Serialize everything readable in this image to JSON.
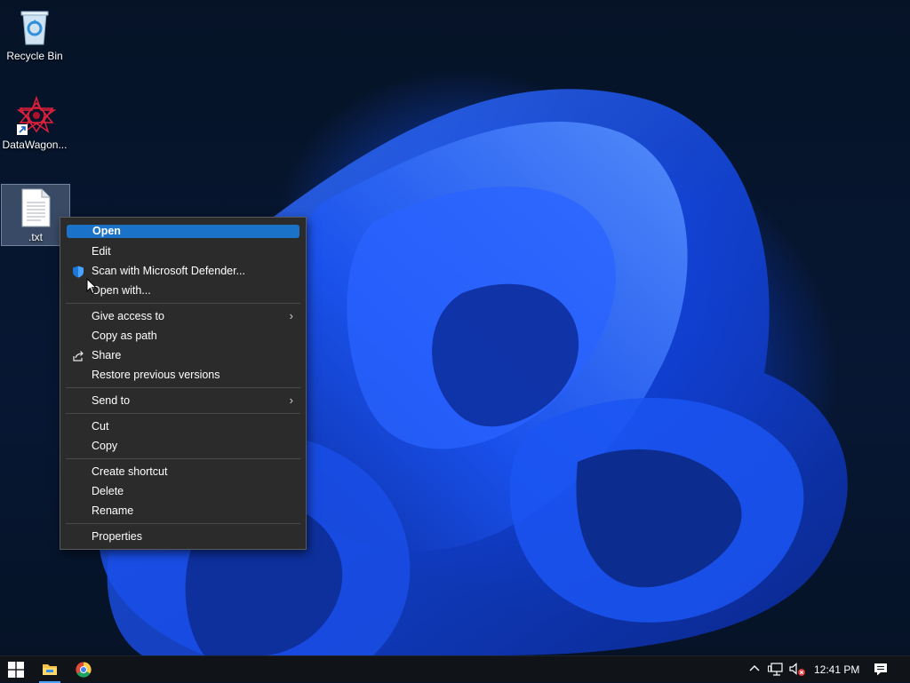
{
  "desktop": {
    "icons": [
      {
        "label": "Recycle Bin"
      },
      {
        "label": "DataWagon..."
      },
      {
        "label": ".txt"
      }
    ]
  },
  "context_menu": {
    "items": [
      {
        "label": "Open"
      },
      {
        "label": "Edit"
      },
      {
        "label": "Scan with Microsoft Defender..."
      },
      {
        "label": "Open with..."
      },
      {
        "label": "Give access to"
      },
      {
        "label": "Copy as path"
      },
      {
        "label": "Share"
      },
      {
        "label": "Restore previous versions"
      },
      {
        "label": "Send to"
      },
      {
        "label": "Cut"
      },
      {
        "label": "Copy"
      },
      {
        "label": "Create shortcut"
      },
      {
        "label": "Delete"
      },
      {
        "label": "Rename"
      },
      {
        "label": "Properties"
      }
    ],
    "submenu_arrow": "›"
  },
  "taskbar": {
    "clock": "12:41 PM"
  },
  "colors": {
    "menu_background": "#2b2b2b",
    "menu_highlight": "#1a73c8",
    "taskbar": "#101317"
  }
}
